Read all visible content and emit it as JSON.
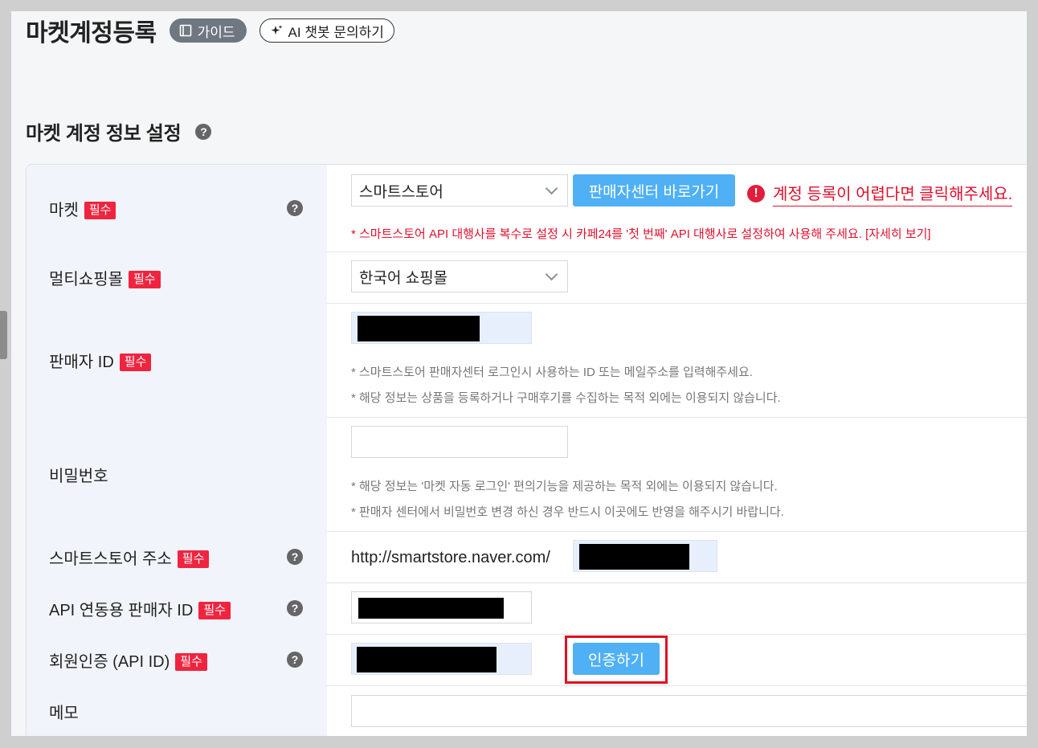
{
  "header": {
    "title": "마켓계정등록",
    "guide_label": "가이드",
    "ai_label": "AI 챗봇 문의하기"
  },
  "section": {
    "title": "마켓 계정 정보 설정"
  },
  "required_badge": "필수",
  "rows": {
    "market": {
      "label": "마켓",
      "select_value": "스마트스토어",
      "button_label": "판매자센터 바로가기",
      "warning_text": "계정 등록이 어렵다면 클릭해주세요.",
      "note": "* 스마트스토어 API 대행사를 복수로 설정 시 카페24를 '첫 번째' API 대행사로 설정하여 사용해 주세요. [자세히 보기]"
    },
    "multi_mall": {
      "label": "멀티쇼핑몰",
      "select_value": "한국어 쇼핑몰"
    },
    "seller_id": {
      "label": "판매자 ID",
      "note1": "* 스마트스토어 판매자센터 로그인시 사용하는 ID 또는 메일주소를 입력해주세요.",
      "note2": "* 해당 정보는 상품을 등록하거나 구매후기를 수집하는 목적 외에는 이용되지 않습니다."
    },
    "password": {
      "label": "비밀번호",
      "note1": "* 해당 정보는 '마켓 자동 로그인' 편의기능을 제공하는 목적 외에는 이용되지 않습니다.",
      "note2": "* 판매자 센터에서 비밀번호 변경 하신 경우 반드시 이곳에도 반영을 해주시기 바랍니다."
    },
    "store_url": {
      "label": "스마트스토어 주소",
      "prefix": "http://smartstore.naver.com/"
    },
    "api_seller_id": {
      "label": "API 연동용 판매자 ID"
    },
    "member_auth": {
      "label": "회원인증 (API ID)",
      "button_label": "인증하기"
    },
    "memo": {
      "label": "메모"
    }
  },
  "colors": {
    "accent_blue": "#4fb0f5",
    "required_red": "#f0243f",
    "warning_red": "#e2102d",
    "label_bg": "#f1f5fb"
  }
}
